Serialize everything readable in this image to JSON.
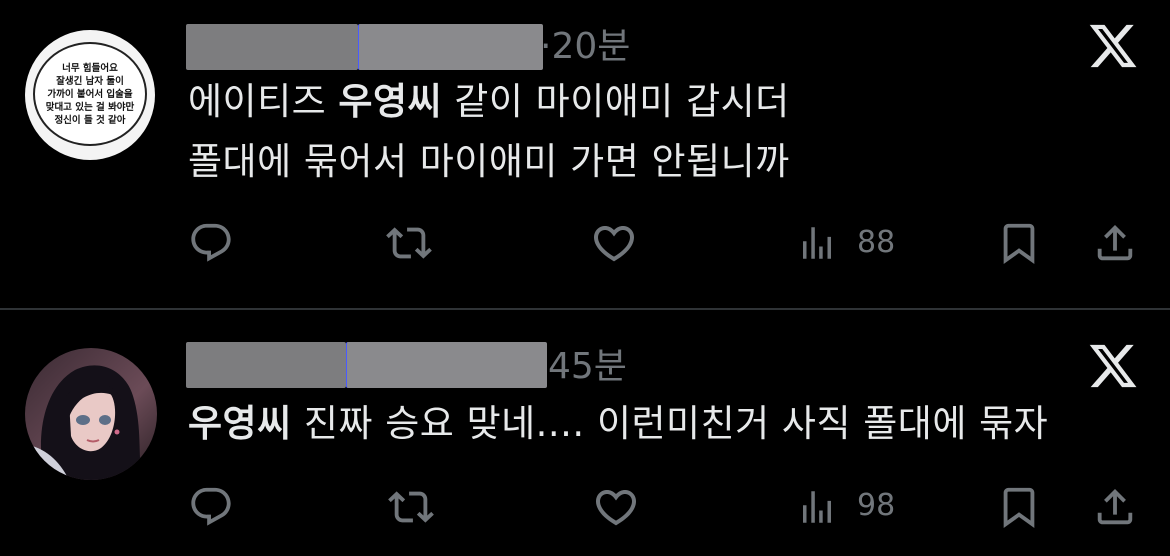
{
  "tweets": [
    {
      "avatar_bubble_lines": [
        "너무 힘들어요",
        "잘생긴 남자 둘이",
        "가까이 붙어서 입술을",
        "맞대고 있는 걸 봐야만",
        "정신이 들 것 같아"
      ],
      "time": "·20분",
      "lines": [
        {
          "prefix": "에이티즈 ",
          "name": "우영씨",
          "suffix": " 같이 마이애미 갑시더"
        },
        {
          "text": "폴대에 묶어서 마이애미 가면 안됩니까"
        }
      ],
      "views": "88"
    },
    {
      "time": "45분",
      "lines": [
        {
          "name": "우영씨",
          "suffix": " 진짜 승요 맞네.... 이런미친거 사직 폴대에 묶자"
        }
      ],
      "views": "98"
    }
  ],
  "icons": {
    "reply": "reply-icon",
    "retweet": "retweet-icon",
    "like": "like-icon",
    "views": "views-icon",
    "bookmark": "bookmark-icon",
    "share": "share-icon",
    "x_logo": "x-logo-icon"
  },
  "colors": {
    "background": "#000000",
    "text": "#e7e9ea",
    "muted": "#71767b",
    "divider": "#2f3336"
  }
}
